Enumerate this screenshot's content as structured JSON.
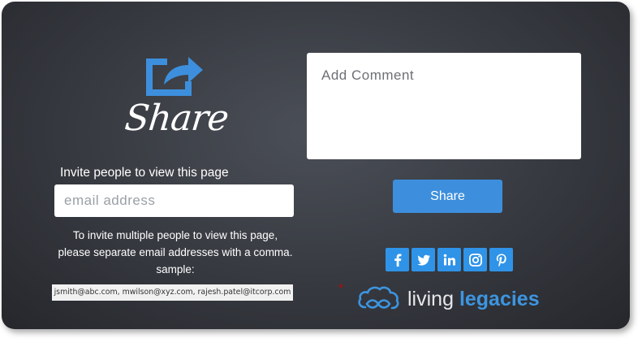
{
  "header": {
    "title": "Share",
    "icon": "share-arrow-icon"
  },
  "invite": {
    "heading": "Invite people to view this page",
    "email_placeholder": "email address",
    "help_line1": "To invite multiple people to view this page,",
    "help_line2": "please separate email addresses with a comma.",
    "sample_label": "sample:",
    "sample_emails": "jsmith@abc.com, mwilson@xyz.com, rajesh.patel@itcorp.com"
  },
  "comment": {
    "placeholder": "Add Comment"
  },
  "share_button": {
    "label": "Share"
  },
  "social": [
    {
      "name": "facebook",
      "icon": "facebook-icon"
    },
    {
      "name": "twitter",
      "icon": "twitter-icon"
    },
    {
      "name": "linkedin",
      "icon": "linkedin-icon"
    },
    {
      "name": "instagram",
      "icon": "instagram-icon"
    },
    {
      "name": "pinterest",
      "icon": "pinterest-icon"
    }
  ],
  "brand": {
    "word1": "living",
    "word2": "legacies",
    "icon": "cloud-infinity-icon"
  },
  "colors": {
    "accent": "#3d8fdd",
    "social": "#2f93e8",
    "panel": "#3a3d44",
    "brand_accent": "#3d95e0"
  }
}
